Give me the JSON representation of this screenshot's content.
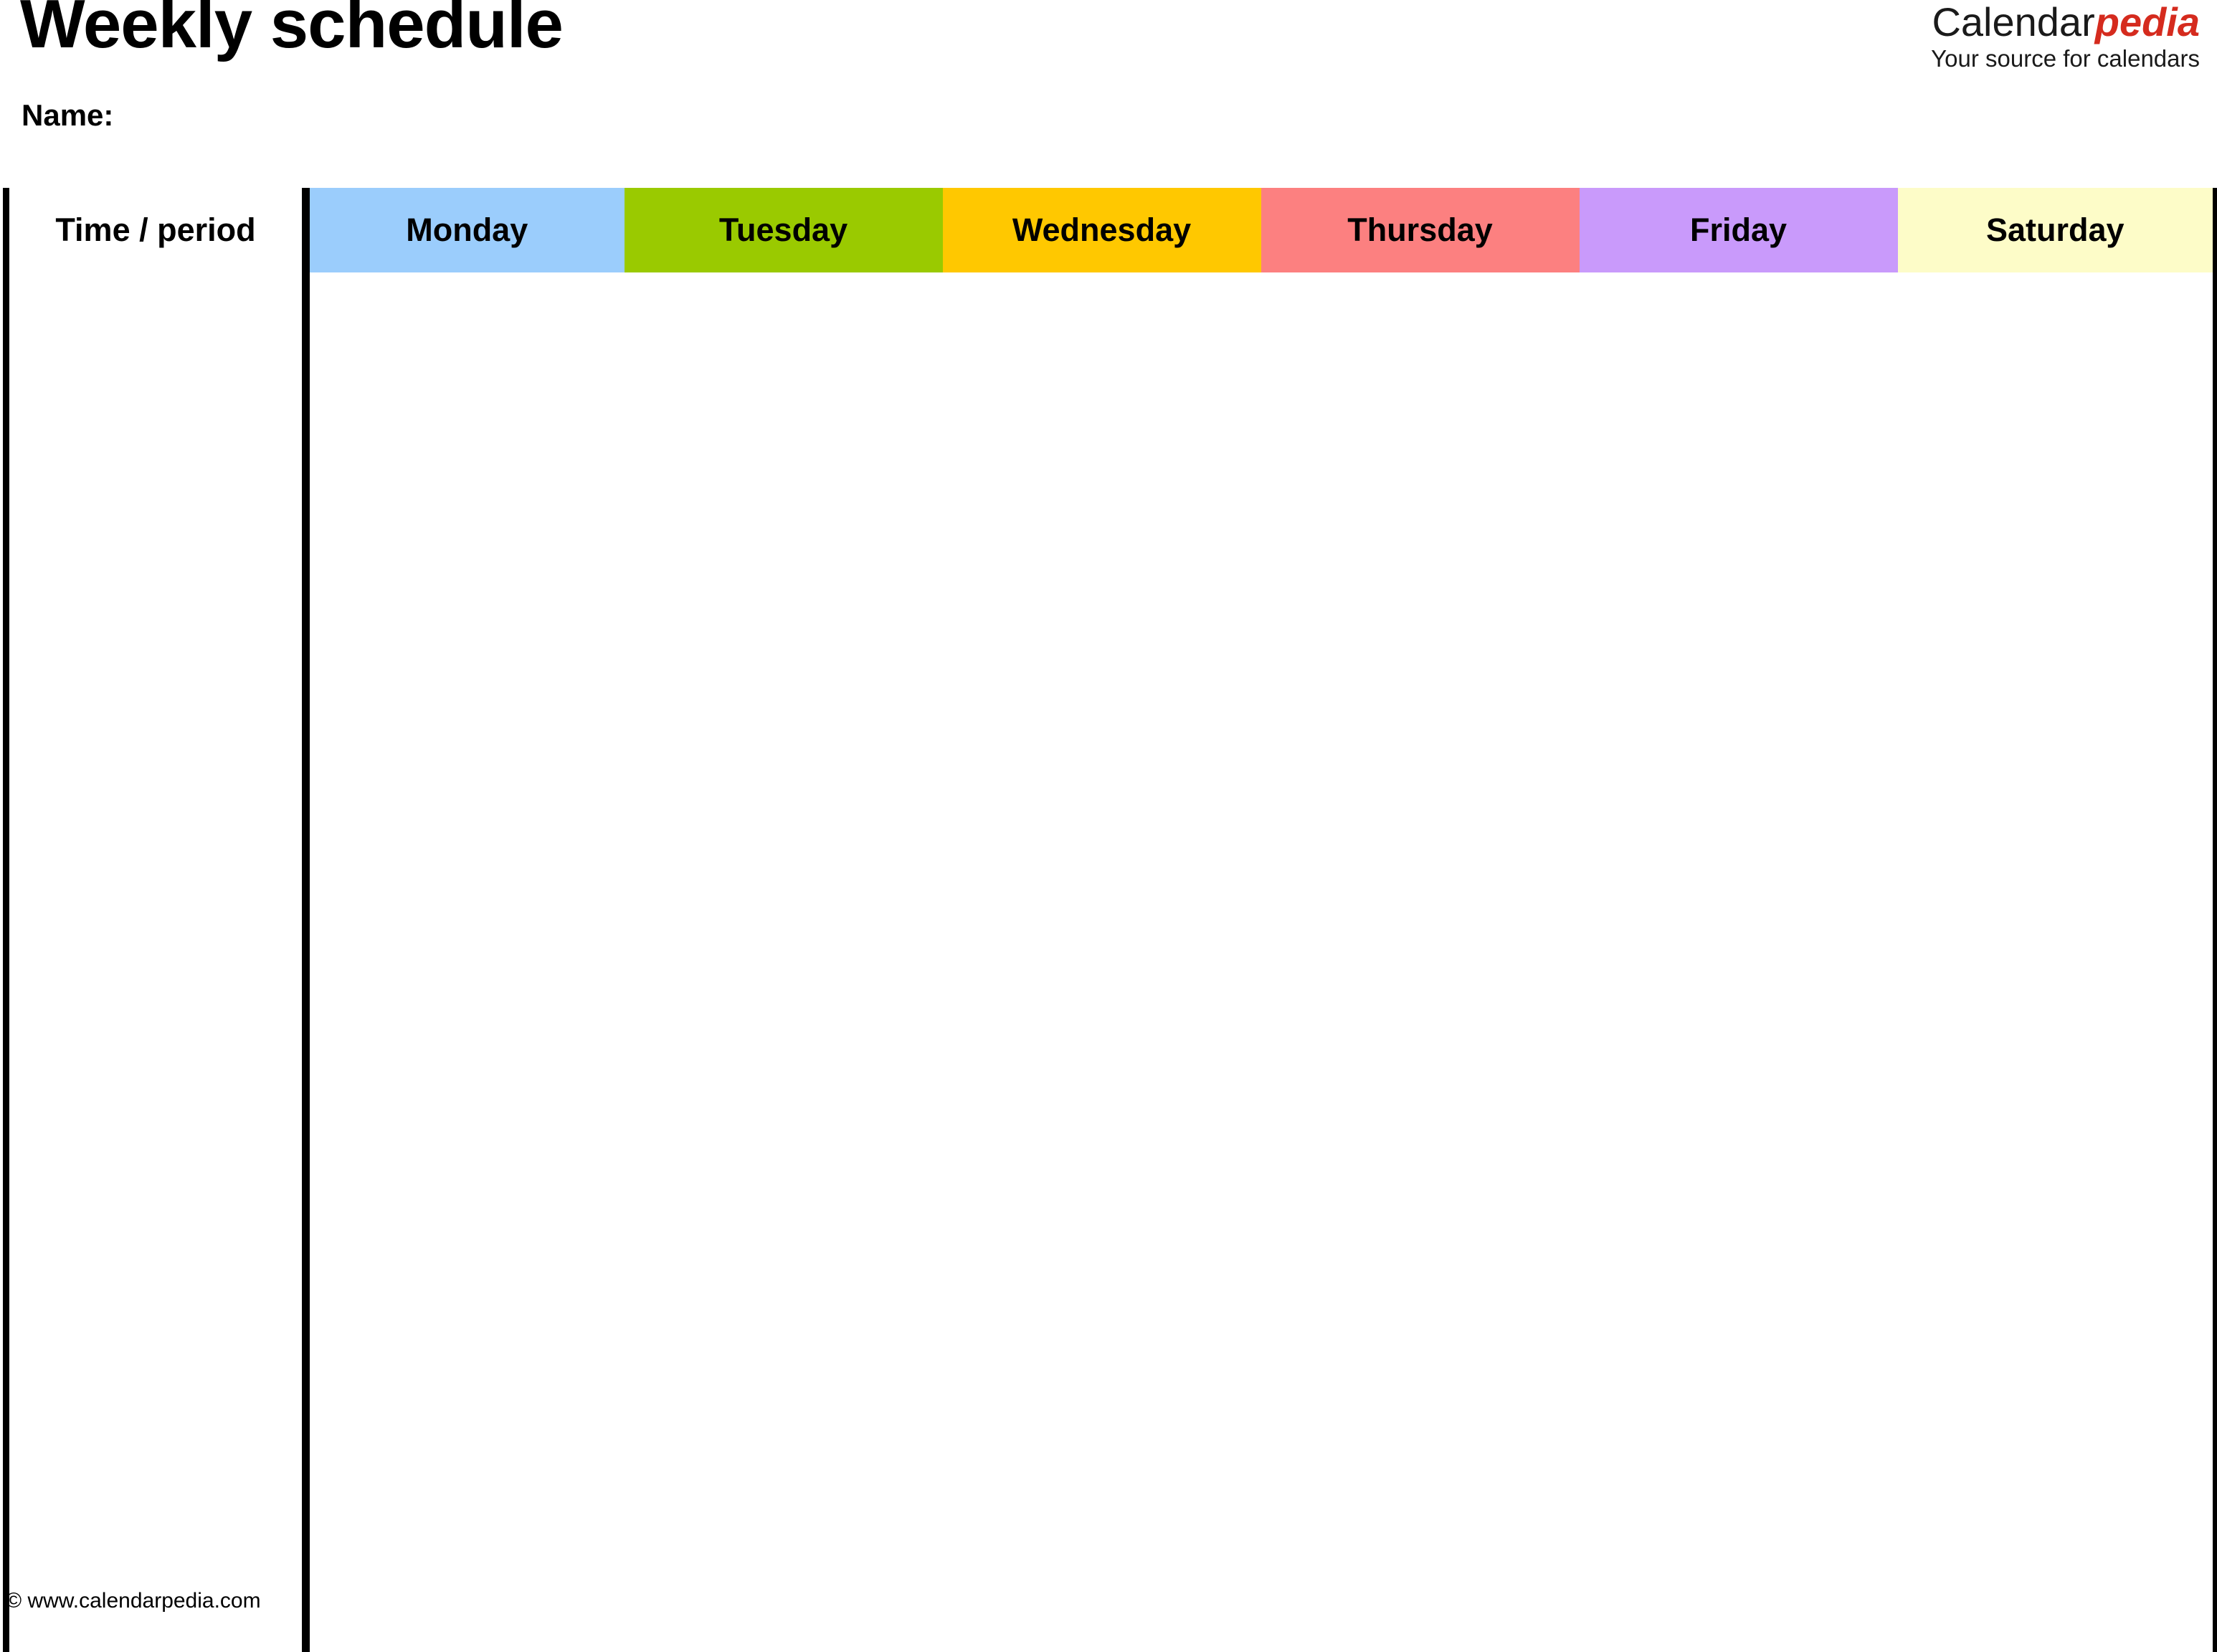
{
  "document": {
    "title": "Weekly schedule",
    "name_label": "Name:"
  },
  "brand": {
    "name_part1": "Calendar",
    "name_part2": "pedia",
    "tagline": "Your source for calendars",
    "accent_color": "#d52b1e",
    "text_color": "#1a1a1a"
  },
  "table": {
    "columns": [
      {
        "key": "time",
        "label": "Time / period",
        "bg": "#ffffff"
      },
      {
        "key": "monday",
        "label": "Monday",
        "bg": "#9bcdfc"
      },
      {
        "key": "tuesday",
        "label": "Tuesday",
        "bg": "#9aca00"
      },
      {
        "key": "wednesday",
        "label": "Wednesday",
        "bg": "#ffc800"
      },
      {
        "key": "thursday",
        "label": "Thursday",
        "bg": "#fc8080"
      },
      {
        "key": "friday",
        "label": "Friday",
        "bg": "#c99afb"
      },
      {
        "key": "saturday",
        "label": "Saturday",
        "bg": "#fdfcc8"
      }
    ],
    "row_count": 13,
    "rows": [
      {
        "time": "",
        "monday": "",
        "tuesday": "",
        "wednesday": "",
        "thursday": "",
        "friday": "",
        "saturday": ""
      },
      {
        "time": "",
        "monday": "",
        "tuesday": "",
        "wednesday": "",
        "thursday": "",
        "friday": "",
        "saturday": ""
      },
      {
        "time": "",
        "monday": "",
        "tuesday": "",
        "wednesday": "",
        "thursday": "",
        "friday": "",
        "saturday": ""
      },
      {
        "time": "",
        "monday": "",
        "tuesday": "",
        "wednesday": "",
        "thursday": "",
        "friday": "",
        "saturday": ""
      },
      {
        "time": "",
        "monday": "",
        "tuesday": "",
        "wednesday": "",
        "thursday": "",
        "friday": "",
        "saturday": ""
      },
      {
        "time": "",
        "monday": "",
        "tuesday": "",
        "wednesday": "",
        "thursday": "",
        "friday": "",
        "saturday": ""
      },
      {
        "time": "",
        "monday": "",
        "tuesday": "",
        "wednesday": "",
        "thursday": "",
        "friday": "",
        "saturday": ""
      },
      {
        "time": "",
        "monday": "",
        "tuesday": "",
        "wednesday": "",
        "thursday": "",
        "friday": "",
        "saturday": ""
      },
      {
        "time": "",
        "monday": "",
        "tuesday": "",
        "wednesday": "",
        "thursday": "",
        "friday": "",
        "saturday": ""
      },
      {
        "time": "",
        "monday": "",
        "tuesday": "",
        "wednesday": "",
        "thursday": "",
        "friday": "",
        "saturday": ""
      },
      {
        "time": "",
        "monday": "",
        "tuesday": "",
        "wednesday": "",
        "thursday": "",
        "friday": "",
        "saturday": ""
      },
      {
        "time": "",
        "monday": "",
        "tuesday": "",
        "wednesday": "",
        "thursday": "",
        "friday": "",
        "saturday": ""
      },
      {
        "time": "",
        "monday": "",
        "tuesday": "",
        "wednesday": "",
        "thursday": "",
        "friday": "",
        "saturday": ""
      }
    ]
  },
  "footer": {
    "copyright": "© www.calendarpedia.com"
  }
}
